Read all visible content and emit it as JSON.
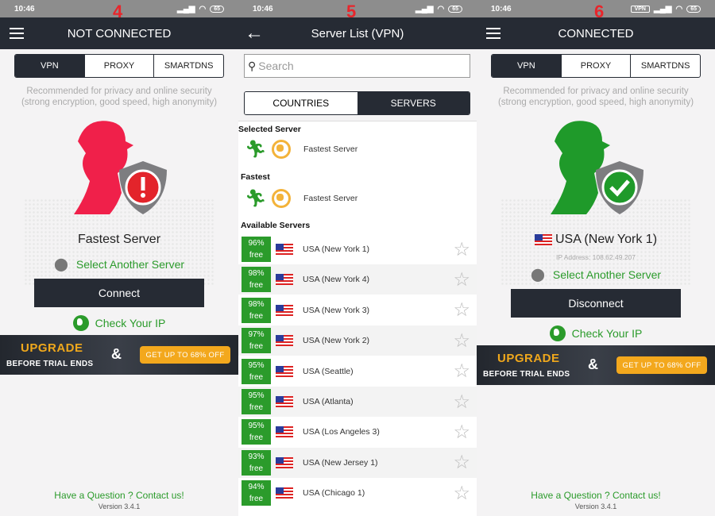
{
  "markers": [
    "4",
    "5",
    "6"
  ],
  "status": {
    "time": "10:46",
    "battery": "65",
    "vpn_badge": "VPN"
  },
  "colors": {
    "header": "#262b34",
    "green": "#2b9b2b",
    "red": "#f0204a",
    "orange": "#f3a81d"
  },
  "common": {
    "tabs": [
      "VPN",
      "PROXY",
      "SMARTDNS"
    ],
    "recommend1": "Recommended for privacy and online security",
    "recommend2": "(strong encryption, good speed, high anonymity)",
    "select_another": "Select Another Server",
    "check_ip": "Check Your IP",
    "upgrade": "UPGRADE",
    "before_trial": "BEFORE TRIAL ENDS",
    "amp": "&",
    "offer": "GET UP TO 68% OFF",
    "footer": "Have a Question ? Contact us!",
    "version": "Version 3.4.1"
  },
  "screen4": {
    "title": "NOT CONNECTED",
    "server": "Fastest Server",
    "button": "Connect"
  },
  "screen6": {
    "title": "CONNECTED",
    "server": "USA (New York 1)",
    "ip": "IP Address: 108.62.49.207",
    "button": "Disconnect"
  },
  "screen5": {
    "title": "Server List (VPN)",
    "search_placeholder": "Search",
    "tabs": [
      "COUNTRIES",
      "SERVERS"
    ],
    "selected_heading": "Selected Server",
    "selected": "Fastest Server",
    "fastest_heading": "Fastest",
    "fastest": "Fastest Server",
    "available_heading": "Available Servers",
    "servers": [
      {
        "pct": "96%",
        "free": "free",
        "name": "USA (New York 1)"
      },
      {
        "pct": "98%",
        "free": "free",
        "name": "USA (New York 4)"
      },
      {
        "pct": "98%",
        "free": "free",
        "name": "USA (New York 3)"
      },
      {
        "pct": "97%",
        "free": "free",
        "name": "USA (New York 2)"
      },
      {
        "pct": "95%",
        "free": "free",
        "name": "USA (Seattle)"
      },
      {
        "pct": "95%",
        "free": "free",
        "name": "USA (Atlanta)"
      },
      {
        "pct": "95%",
        "free": "free",
        "name": "USA (Los Angeles 3)"
      },
      {
        "pct": "93%",
        "free": "free",
        "name": "USA (New Jersey 1)"
      },
      {
        "pct": "94%",
        "free": "free",
        "name": "USA (Chicago 1)"
      }
    ]
  }
}
